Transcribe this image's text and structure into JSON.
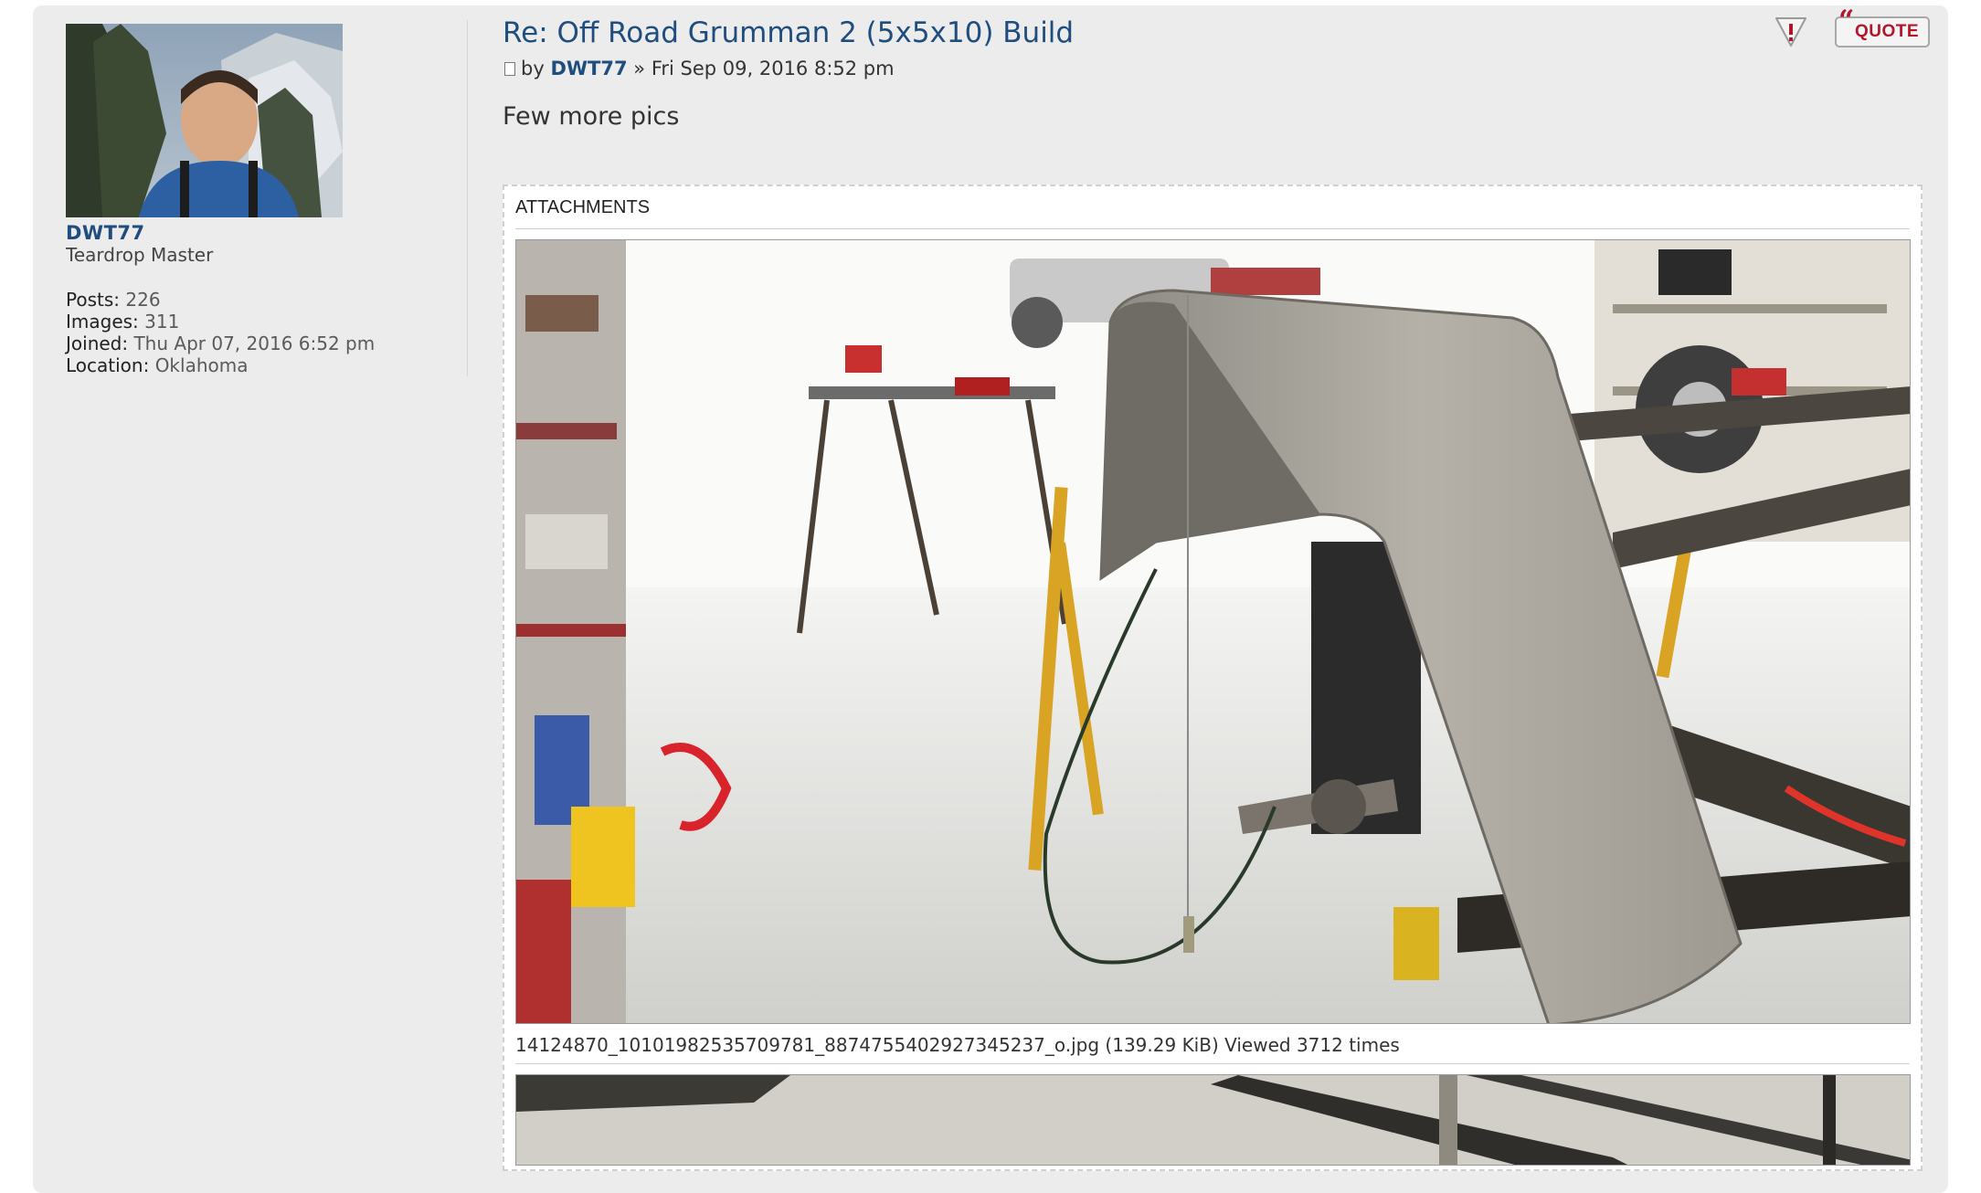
{
  "author": {
    "username": "DWT77",
    "rank": "Teardrop Master",
    "stats": [
      {
        "label": "Posts:",
        "value": "226"
      },
      {
        "label": "Images:",
        "value": "311"
      },
      {
        "label": "Joined:",
        "value": "Thu Apr 07, 2016 6:52 pm"
      },
      {
        "label": "Location:",
        "value": "Oklahoma"
      }
    ]
  },
  "post": {
    "title": "Re: Off Road Grumman 2 (5x5x10) Build",
    "meta_by": "by",
    "meta_author": "DWT77",
    "meta_date": "» Fri Sep 09, 2016 8:52 pm",
    "text": "Few more pics"
  },
  "actions": {
    "quote_label": "QUOTE",
    "quote_mark": "“"
  },
  "attachments": {
    "label": "ATTACHMENTS",
    "items": [
      {
        "caption": "14124870_10101982535709781_8874755402927345237_o.jpg (139.29 KiB) Viewed 3712 times"
      }
    ]
  },
  "colors": {
    "link": "#1f4d7e",
    "quote_red": "#b3152a",
    "panel_bg": "#ececec"
  }
}
